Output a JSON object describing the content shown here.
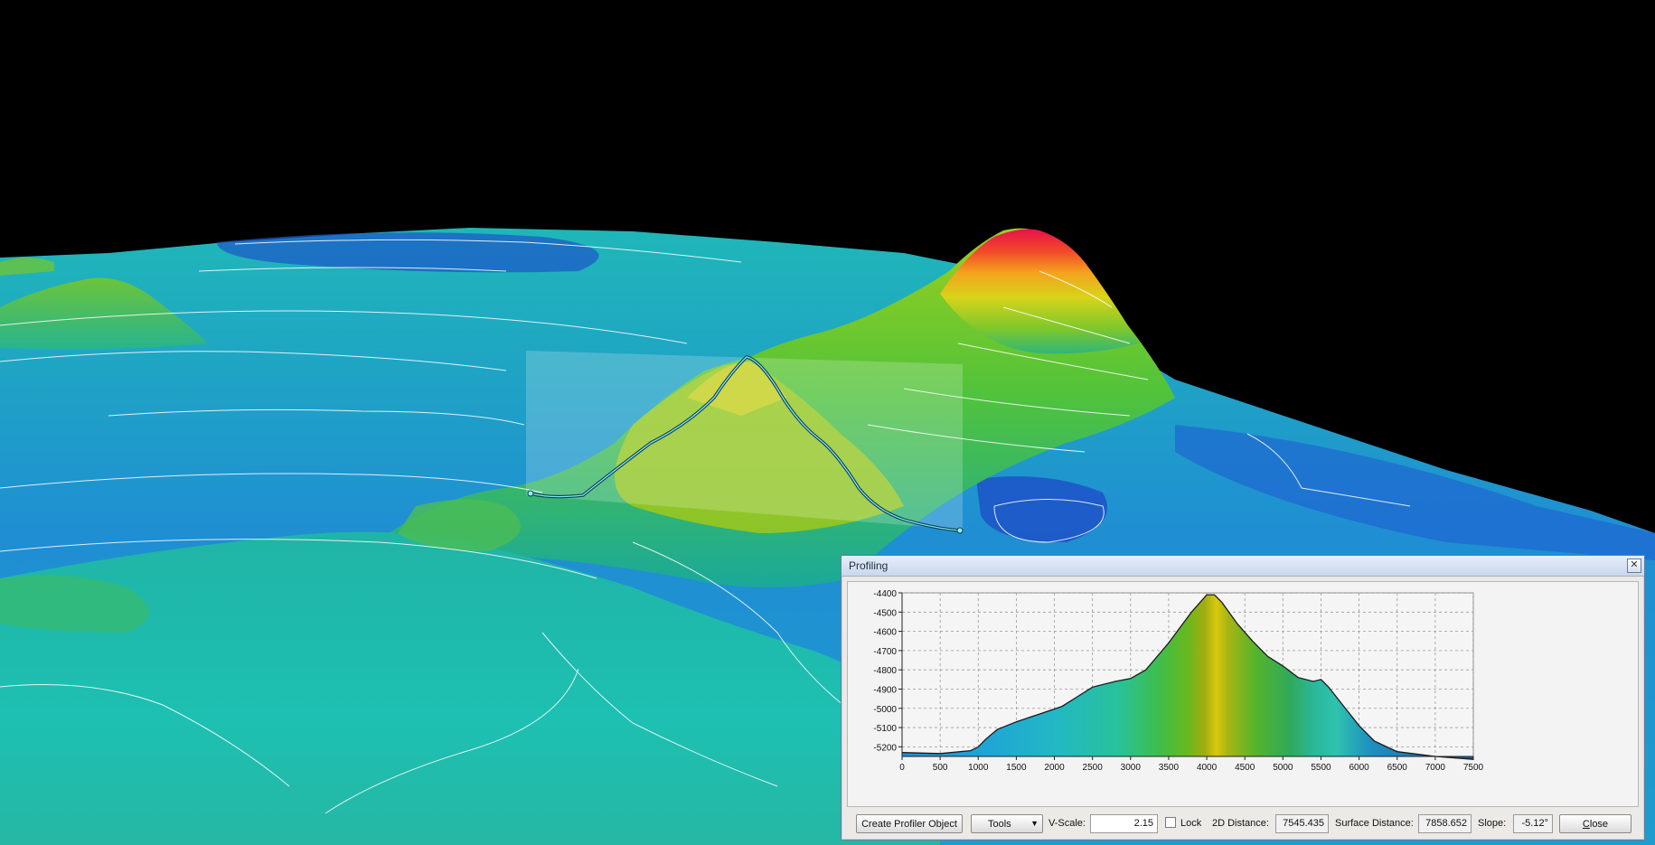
{
  "dialog": {
    "title": "Profiling",
    "close_icon": "close-icon",
    "create_button": "Create Profiler Object",
    "tools_label": "Tools",
    "vscale_label": "V-Scale:",
    "vscale_value": "2.15",
    "lock_label": "Lock",
    "lock_checked": false,
    "distance2d_label": "2D Distance:",
    "distance2d_value": "7545.435",
    "surface_label": "Surface Distance:",
    "surface_value": "7858.652",
    "slope_label": "Slope:",
    "slope_value": "-5.12°",
    "close_button_first": "C",
    "close_button_rest": "lose"
  },
  "chart_data": {
    "type": "area",
    "xlim": [
      0,
      7500
    ],
    "ylim": [
      -5250,
      -4400
    ],
    "x_ticks": [
      "0",
      "500",
      "1000",
      "1500",
      "2000",
      "2500",
      "3000",
      "3500",
      "4000",
      "4500",
      "5000",
      "5500",
      "6000",
      "6500",
      "7000",
      "7500"
    ],
    "y_ticks": [
      "-4400",
      "-4500",
      "-4600",
      "-4700",
      "-4800",
      "-4900",
      "-5000",
      "-5100",
      "-5200"
    ],
    "grid": true,
    "x": [
      0,
      500,
      900,
      1000,
      1100,
      1250,
      1500,
      1800,
      2100,
      2300,
      2500,
      2800,
      3000,
      3200,
      3500,
      3800,
      4000,
      4100,
      4200,
      4400,
      4600,
      4800,
      5000,
      5200,
      5400,
      5500,
      5600,
      5800,
      6000,
      6200,
      6500,
      7000,
      7500
    ],
    "y": [
      -5230,
      -5235,
      -5220,
      -5200,
      -5160,
      -5110,
      -5070,
      -5030,
      -4990,
      -4940,
      -4890,
      -4860,
      -4845,
      -4800,
      -4660,
      -4500,
      -4410,
      -4410,
      -4450,
      -4560,
      -4650,
      -4730,
      -4780,
      -4840,
      -4860,
      -4850,
      -4890,
      -4990,
      -5090,
      -5170,
      -5225,
      -5250,
      -5265
    ]
  }
}
